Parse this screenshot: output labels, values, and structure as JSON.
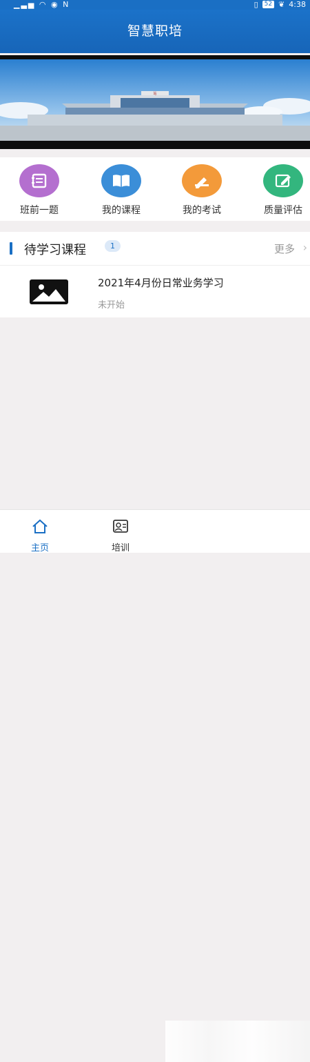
{
  "status_bar": {
    "left_icons": "signal wifi eye nfc",
    "battery": "52",
    "time": "4:38"
  },
  "header": {
    "title": "智慧职培"
  },
  "quick_actions": [
    {
      "label": "班前一题",
      "icon": "notes-icon",
      "color": "#b46fcf"
    },
    {
      "label": "我的课程",
      "icon": "book-icon",
      "color": "#3b8ed8"
    },
    {
      "label": "我的考试",
      "icon": "pen-paper-icon",
      "color": "#f39a3a"
    },
    {
      "label": "质量评估",
      "icon": "edit-note-icon",
      "color": "#33b67e"
    }
  ],
  "section": {
    "title": "待学习课程",
    "count": "1",
    "more": "更多",
    "courses": [
      {
        "title": "2021年4月份日常业务学习",
        "status": "未开始"
      }
    ]
  },
  "tabbar": {
    "tabs": [
      {
        "label": "主页",
        "icon": "home-icon"
      },
      {
        "label": "培训",
        "icon": "training-icon"
      }
    ]
  },
  "colors": {
    "primary": "#1a6fc4",
    "background": "#f2eff0"
  }
}
